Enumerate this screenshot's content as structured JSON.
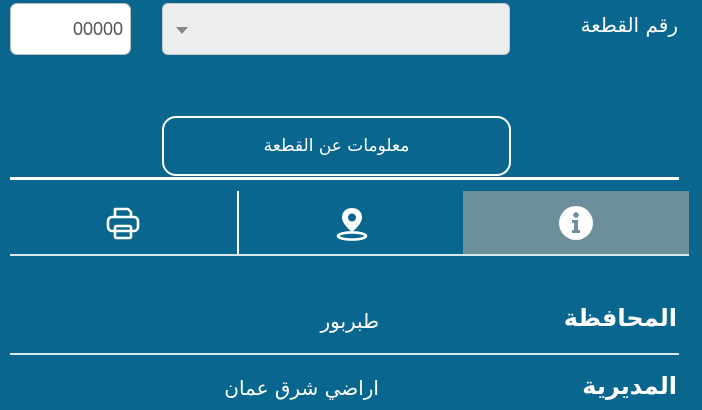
{
  "plot_number": {
    "label": "رقم القطعة",
    "input_value": "00000"
  },
  "info_button": {
    "label": "معلومات عن القطعة"
  },
  "tabs": [
    {
      "name": "info",
      "icon": "info-icon",
      "active": true
    },
    {
      "name": "location",
      "icon": "location-pin-icon",
      "active": false
    },
    {
      "name": "print",
      "icon": "printer-icon",
      "active": false
    }
  ],
  "details": [
    {
      "label": "المحافظة",
      "value": "طبربور"
    },
    {
      "label": "المديرية",
      "value": "اراضي شرق عمان"
    }
  ],
  "colors": {
    "background": "#09668e",
    "active_tab": "#6c8f9b",
    "text": "#ffffff"
  }
}
